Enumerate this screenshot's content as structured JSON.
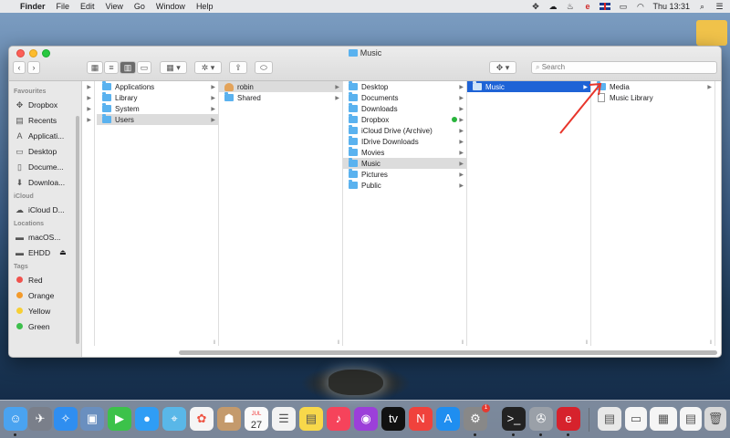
{
  "menubar": {
    "app": "Finder",
    "items": [
      "File",
      "Edit",
      "View",
      "Go",
      "Window",
      "Help"
    ],
    "clock": "Thu 13:31"
  },
  "window": {
    "title": "Music",
    "search_placeholder": "Search"
  },
  "sidebar": {
    "favourites_label": "Favourites",
    "favourites": [
      "Dropbox",
      "Recents",
      "Applicati...",
      "Desktop",
      "Docume...",
      "Downloa..."
    ],
    "icloud_label": "iCloud",
    "icloud": [
      "iCloud D..."
    ],
    "locations_label": "Locations",
    "locations": [
      "macOS...",
      "EHDD"
    ],
    "tags_label": "Tags",
    "tags": [
      {
        "label": "Red",
        "color": "#f0524d"
      },
      {
        "label": "Orange",
        "color": "#f39a2b"
      },
      {
        "label": "Yellow",
        "color": "#f7cf34"
      },
      {
        "label": "Green",
        "color": "#3dbf4c"
      }
    ]
  },
  "columns": {
    "col1": [
      "Applications",
      "Library",
      "System",
      "Users"
    ],
    "col2": [
      "robin",
      "Shared"
    ],
    "col3": [
      "Desktop",
      "Documents",
      "Downloads",
      "Dropbox",
      "iCloud Drive (Archive)",
      "IDrive Downloads",
      "Movies",
      "Music",
      "Pictures",
      "Public"
    ],
    "col4": [
      "Music"
    ],
    "col5": [
      "Media",
      "Music Library"
    ]
  },
  "dock": {
    "calendar_month": "JUL",
    "calendar_day": "27",
    "appstore_badge": "1"
  },
  "colors": {
    "selection_active": "#1e63d6",
    "folder": "#5ab2ef",
    "annotation_arrow": "#e8352b"
  }
}
